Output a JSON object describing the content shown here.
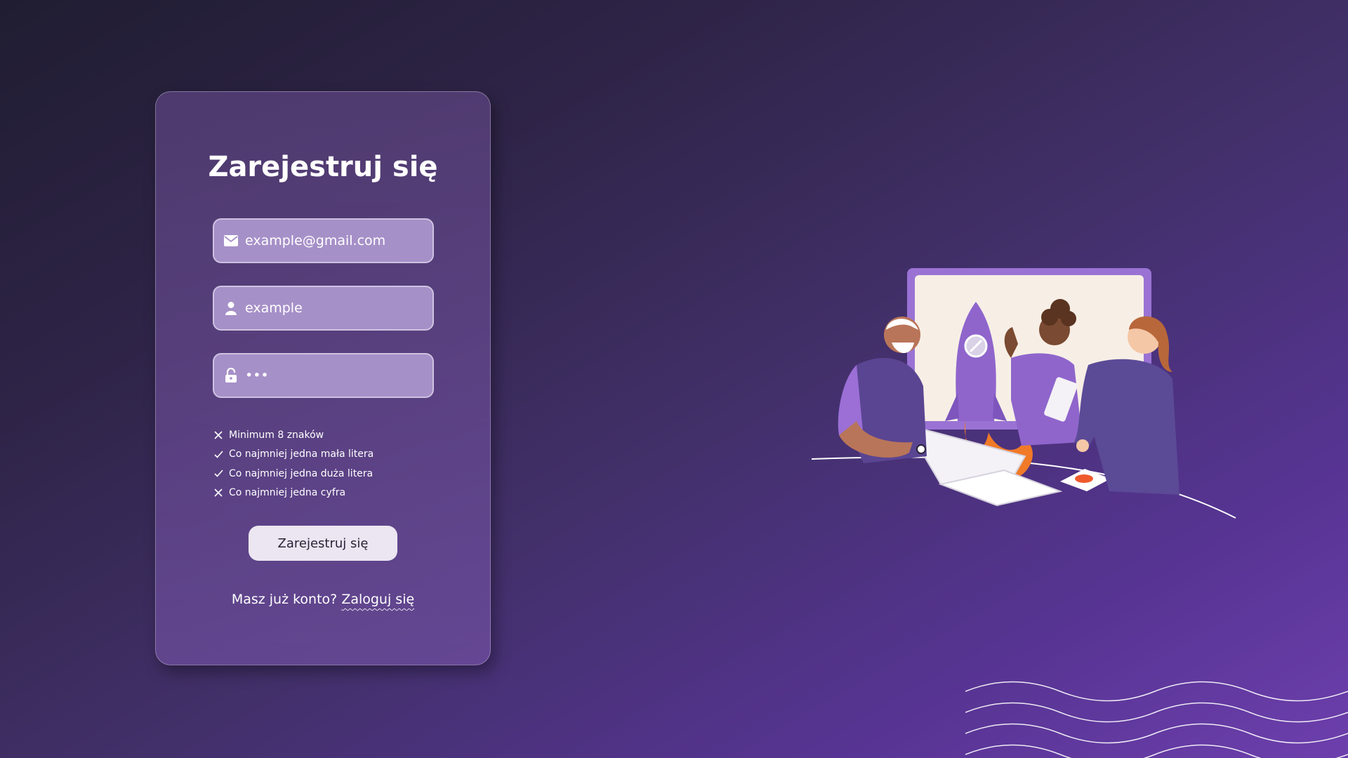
{
  "form": {
    "title": "Zarejestruj się",
    "email": {
      "value": "",
      "placeholder": "example@gmail.com",
      "icon": "envelope-icon"
    },
    "username": {
      "value": "",
      "placeholder": "example",
      "icon": "user-icon"
    },
    "password": {
      "value": "",
      "placeholder": "•••",
      "icon": "lock-icon"
    },
    "requirements": [
      {
        "label": "Minimum 8 znaków",
        "met": false,
        "icon": "x-icon"
      },
      {
        "label": "Co najmniej jedna mała litera",
        "met": true,
        "icon": "check-icon"
      },
      {
        "label": "Co najmniej jedna duża litera",
        "met": true,
        "icon": "check-icon"
      },
      {
        "label": "Co najmniej jedna cyfra",
        "met": false,
        "icon": "x-icon"
      }
    ],
    "submit_label": "Zarejestruj się",
    "login_prompt": "Masz już konto?",
    "login_link": "Zaloguj się"
  },
  "colors": {
    "field_bg": "#a690c8",
    "button_bg": "#ebe6f1",
    "accent_orange": "#f07a28",
    "accent_purple": "#9b6fd6"
  }
}
